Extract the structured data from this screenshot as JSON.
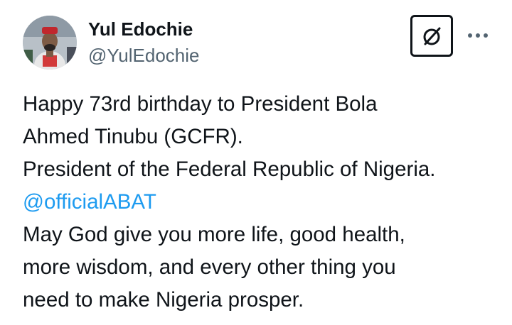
{
  "author": {
    "display_name": "Yul Edochie",
    "handle": "@YulEdochie",
    "avatar_icon": "profile-photo"
  },
  "actions": {
    "grok_icon": "grok-icon",
    "more_icon": "more-horizontal-icon"
  },
  "tweet": {
    "lines": [
      "Happy 73rd birthday to President Bola",
      "Ahmed Tinubu (GCFR).",
      "President of the Federal Republic of Nigeria.",
      "@officialABAT",
      "May God give you more life, good health,",
      "more wisdom, and every other thing you",
      "need to make Nigeria prosper."
    ],
    "mention_color": "#1d9bf0"
  }
}
